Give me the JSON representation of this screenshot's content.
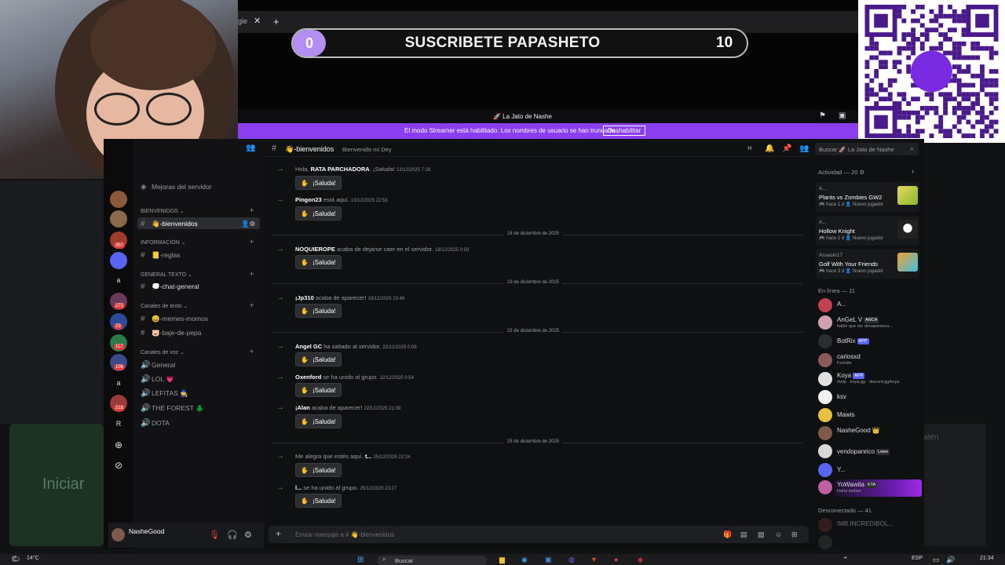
{
  "browser": {
    "tab_fragment": "gle",
    "tab_close": "✕",
    "tab_new": "+"
  },
  "overlay": {
    "sub_left": "0",
    "sub_title": "SUSCRIBETE PAPASHETO",
    "sub_right": "10"
  },
  "server": {
    "title": "🚀 La Jato de Nashe",
    "streamer_text": "El modo Streamer está habilitado. Los nombres de usuario se han truncado.",
    "streamer_button": "Deshabilitar"
  },
  "guilds": {
    "badges": [
      "357",
      "272",
      "23",
      "117",
      "106",
      "218"
    ],
    "letters": [
      "a",
      "a",
      "R"
    ]
  },
  "channels": {
    "boost": "Mejoras del servidor",
    "categories": {
      "bienvenidos": "BIENVENIDOS ⌄",
      "informacion": "INFORMACIÓN ⌄",
      "general": "GENERAL TEXTO ⌄",
      "texto": "Canales de texto ⌄",
      "voz": "Canales de voz ⌄"
    },
    "bienvenidos": "👋-bienvenidos",
    "reglas": "📒-reglas",
    "chat_general": "💭-chat-general",
    "memes": "😄-memes-momos",
    "pepa": "🐷-baje-de-pepa",
    "voice": [
      "General",
      "LOL 💗",
      "LEFITAS 🧙",
      "THE FOREST 🌲",
      "DOTA"
    ]
  },
  "user": {
    "name": "NasheGood"
  },
  "chat": {
    "channel": "👋-bienvenidos",
    "topic": "Bienvenido mi Dey",
    "search_placeholder": "Buscar 🚀 La Jato de Nashe",
    "composer_placeholder": "Enviar mensaje a # 👋-bienvenidos",
    "wave_label": "¡Saluda!",
    "messages": [
      {
        "pre": "Hola, ",
        "name": "RATA PARCHADORA",
        "post": ". ¡Saluda!",
        "time": "13/12/2025 7:28"
      },
      {
        "pre": "",
        "name": "Pingon23",
        "post": " está aquí.",
        "time": "13/12/2025 22:53"
      },
      {
        "pre": "",
        "name": "NOQUIEROPE",
        "post": " acaba de dejarse caer en el servidor.",
        "time": "18/12/2025 0:03"
      },
      {
        "pre": "",
        "name": "¡Jp310",
        "post": " acaba de aparecer!",
        "time": "19/12/2025 23:46"
      },
      {
        "pre": "",
        "name": "Angel GC",
        "post": " ha saltado al servidor.",
        "time": "22/12/2025 0:08"
      },
      {
        "pre": "",
        "name": "Oxenford",
        "post": " se ha unido al grupo.",
        "time": "22/12/2025 0:54"
      },
      {
        "pre": "",
        "name": "¡Alan",
        "post": " acaba de aparecer!",
        "time": "22/12/2025 21:09"
      },
      {
        "pre": "Me alegra que estés aquí, ",
        "name": "t...",
        "post": "",
        "time": "25/12/2025 22:24"
      },
      {
        "pre": "",
        "name": "l...",
        "post": " se ha unido al grupo.",
        "time": "25/12/2025 23:27"
      }
    ],
    "dividers": [
      "18 de diciembre de 2025",
      "19 de diciembre de 2025",
      "22 de diciembre de 2025",
      "25 de diciembre de 2025"
    ]
  },
  "activity": {
    "header": "Actividad — 20 ⚙",
    "items": [
      {
        "user": "A...",
        "game": "Plants vs Zombies GW2",
        "meta": "hace 1 d",
        "tag": "Nuevo jugador"
      },
      {
        "user": "A...",
        "game": "Hollow Knight",
        "meta": "hace 2 d",
        "tag": "Nuevo jugador"
      },
      {
        "user": "Assasin17",
        "game": "Golf With Your Friends",
        "meta": "hace 3 d",
        "tag": "Nuevo jugador"
      }
    ]
  },
  "members": {
    "online_header": "En línea — 11",
    "offline_header": "Desconectado — 41",
    "list": [
      {
        "name": "A...",
        "status": ""
      },
      {
        "name": "AnGeL V",
        "status": "hable que me desaparezca...",
        "tag": "ARCA"
      },
      {
        "name": "BotRix",
        "status": "",
        "tag": "APP"
      },
      {
        "name": "carlosxd",
        "status": "Fortnite"
      },
      {
        "name": "Koya",
        "status": "/help · koya.gg · discord.gg/koya",
        "tag": "APP"
      },
      {
        "name": "ksv",
        "status": ""
      },
      {
        "name": "Mawis",
        "status": ""
      },
      {
        "name": "NasheGood 👑",
        "status": ""
      },
      {
        "name": "vendopanrico",
        "status": "",
        "tag": "Lwee"
      },
      {
        "name": "Y...",
        "status": ""
      },
      {
        "name": "YoWawita",
        "status": "Haha webon",
        "tag": "KTA"
      }
    ],
    "offline_first": "IMB.INCREDIBOL..."
  },
  "bg": {
    "iniciar": "Iniciar",
    "right_frag": "atén"
  },
  "taskbar": {
    "temp": "14°C",
    "search": "Buscar",
    "lang": "ESP",
    "time": "21:34"
  }
}
